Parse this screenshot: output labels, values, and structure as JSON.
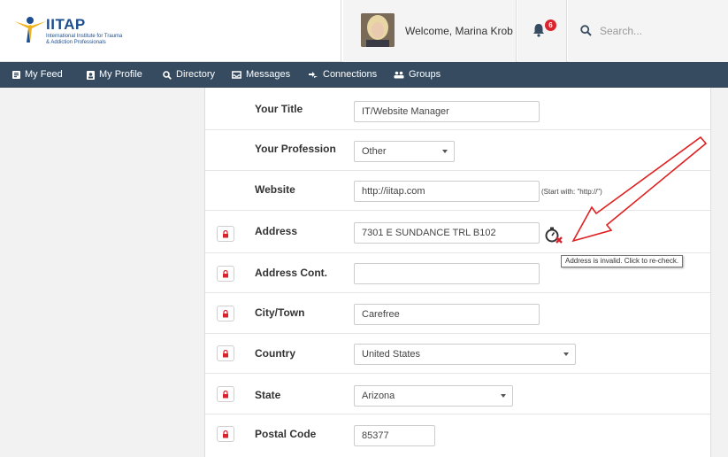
{
  "header": {
    "logo_text": "IITAP",
    "logo_sub": "International Institute for Trauma & Addiction Professionals",
    "welcome": "Welcome, Marina Krob",
    "notification_count": "6",
    "search_placeholder": "Search..."
  },
  "nav": {
    "items": [
      {
        "label": "My Feed",
        "icon": "feed-icon"
      },
      {
        "label": "My Profile",
        "icon": "profile-icon"
      },
      {
        "label": "Directory",
        "icon": "search-icon"
      },
      {
        "label": "Messages",
        "icon": "inbox-icon"
      },
      {
        "label": "Connections",
        "icon": "connections-icon"
      },
      {
        "label": "Groups",
        "icon": "groups-icon"
      }
    ]
  },
  "form": {
    "title_label": "Your Title",
    "title_value": "IT/Website Manager",
    "profession_label": "Your Profession",
    "profession_value": "Other",
    "website_label": "Website",
    "website_value": "http://iitap.com",
    "website_hint": "(Start with: \"http://\")",
    "address_label": "Address",
    "address_value": "7301 E SUNDANCE TRL B102",
    "address_tooltip": "Address is invalid. Click to re-check.",
    "address_cont_label": "Address Cont.",
    "address_cont_value": "",
    "city_label": "City/Town",
    "city_value": "Carefree",
    "country_label": "Country",
    "country_value": "United States",
    "state_label": "State",
    "state_value": "Arizona",
    "postal_label": "Postal Code",
    "postal_value": "85377"
  },
  "colors": {
    "nav_bg": "#364b5f",
    "brand": "#1d4e8f",
    "lock_red": "#d9232d",
    "arrow_red": "#e02020"
  }
}
